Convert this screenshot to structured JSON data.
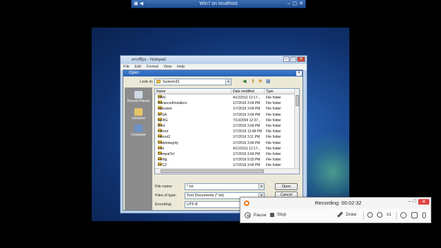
{
  "remote": {
    "title": "Win7 on localhost"
  },
  "notepad": {
    "title": "errofflps - Notepad",
    "menu": [
      "File",
      "Edit",
      "Format",
      "View",
      "Help"
    ]
  },
  "open_dialog": {
    "title": "Open",
    "look_in_label": "Look in:",
    "look_in_value": "System32",
    "places": [
      "Recent Places",
      "Libraries",
      "Computer"
    ],
    "columns": [
      "Name",
      "Date modified",
      "Type"
    ],
    "files": [
      {
        "name": "0409",
        "date": "4/12/2011 12:17...",
        "type": "File folder"
      },
      {
        "name": "AdvancedInstallers",
        "date": "1/7/2016 3:04 PM",
        "type": "File folder"
      },
      {
        "name": "appraiser",
        "date": "1/7/2016 3:04 PM",
        "type": "File folder"
      },
      {
        "name": "ar-SA",
        "date": "1/7/2016 3:04 PM",
        "type": "File folder"
      },
      {
        "name": "bg-BG",
        "date": "7/13/2009 12:37...",
        "type": "File folder"
      },
      {
        "name": "Boot",
        "date": "1/7/2016 3:04 PM",
        "type": "File folder"
      },
      {
        "name": "catroot",
        "date": "1/7/2016 12:48 PM",
        "type": "File folder"
      },
      {
        "name": "catroot2",
        "date": "1/7/2016 3:11 PM",
        "type": "File folder"
      },
      {
        "name": "CodeIntegrity",
        "date": "1/7/2016 3:04 PM",
        "type": "File folder"
      },
      {
        "name": "com",
        "date": "4/12/2011 12:17...",
        "type": "File folder"
      },
      {
        "name": "CompatTel",
        "date": "1/7/2016 3:04 PM",
        "type": "File folder"
      },
      {
        "name": "config",
        "date": "1/7/2016 9:33 PM",
        "type": "File folder"
      },
      {
        "name": "cs-CZ",
        "date": "1/7/2016 3:04 PM",
        "type": "File folder"
      },
      {
        "name": "da-DK",
        "date": "1/7/2016 3:04 PM",
        "type": "File folder"
      },
      {
        "name": "de-DE",
        "date": "1/7/2016 3:04 PM",
        "type": "File folder"
      }
    ],
    "file_name_label": "File name:",
    "file_name_value": "*.txt",
    "file_type_label": "Files of type:",
    "file_type_value": "Text Documents (*.txt)",
    "encoding_label": "Encoding:",
    "encoding_value": "UTF-8",
    "open_btn": "Open",
    "cancel_btn": "Cancel"
  },
  "recorder": {
    "status": "Recording: 00:02:32",
    "pause": "Pause",
    "stop": "Stop",
    "draw": "Draw",
    "zoom": "x1",
    "min": "–",
    "restore": "□",
    "close": "✕",
    "accent": "#f07a1a"
  }
}
